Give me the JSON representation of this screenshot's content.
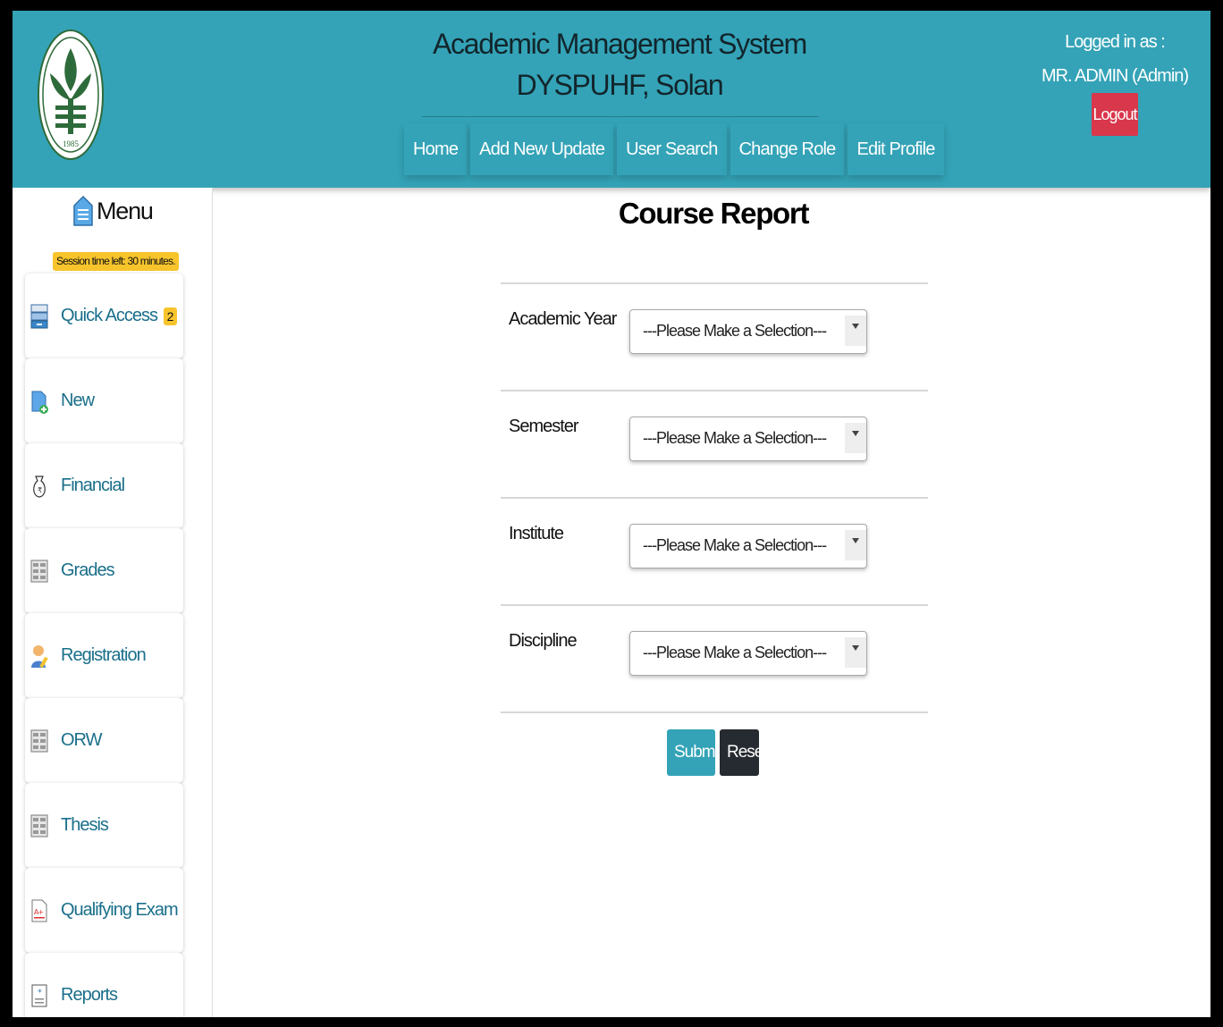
{
  "header": {
    "title_line1": "Academic Management System",
    "title_line2": "DYSPUHF, Solan",
    "logged_in_label": "Logged in as :",
    "user": "MR. ADMIN (Admin)",
    "logout_label": "Logout",
    "logo_year": "1985",
    "nav": [
      {
        "label": "Home"
      },
      {
        "label": "Add New Update"
      },
      {
        "label": "User Search"
      },
      {
        "label": "Change Role"
      },
      {
        "label": "Edit Profile"
      }
    ]
  },
  "sidebar": {
    "menu_title": "Menu",
    "session_text": "Session time left: 30 minutes.",
    "items": [
      {
        "label": "Quick Access",
        "badge": "2",
        "icon": "archive-icon"
      },
      {
        "label": "New",
        "icon": "new-document-icon"
      },
      {
        "label": "Financial",
        "icon": "money-bag-icon"
      },
      {
        "label": "Grades",
        "icon": "grid-list-icon"
      },
      {
        "label": "Registration",
        "icon": "user-edit-icon"
      },
      {
        "label": "ORW",
        "icon": "grid-list-icon"
      },
      {
        "label": "Thesis",
        "icon": "grid-list-icon"
      },
      {
        "label": "Qualifying Exam",
        "icon": "exam-paper-icon"
      },
      {
        "label": "Reports",
        "icon": "report-icon"
      }
    ]
  },
  "main": {
    "page_title": "Course Report",
    "fields": [
      {
        "label": "Academic Year",
        "value": "---Please Make a Selection---"
      },
      {
        "label": "Semester",
        "value": "---Please Make a Selection---"
      },
      {
        "label": "Institute",
        "value": "---Please Make a Selection---"
      },
      {
        "label": "Discipline",
        "value": "---Please Make a Selection---"
      }
    ],
    "submit_label": "Submit",
    "reset_label": "Reset"
  },
  "colors": {
    "header_bg": "#34a3b7",
    "logout_bg": "#d9374b",
    "badge_bg": "#f7c42c",
    "reset_bg": "#262b31"
  }
}
